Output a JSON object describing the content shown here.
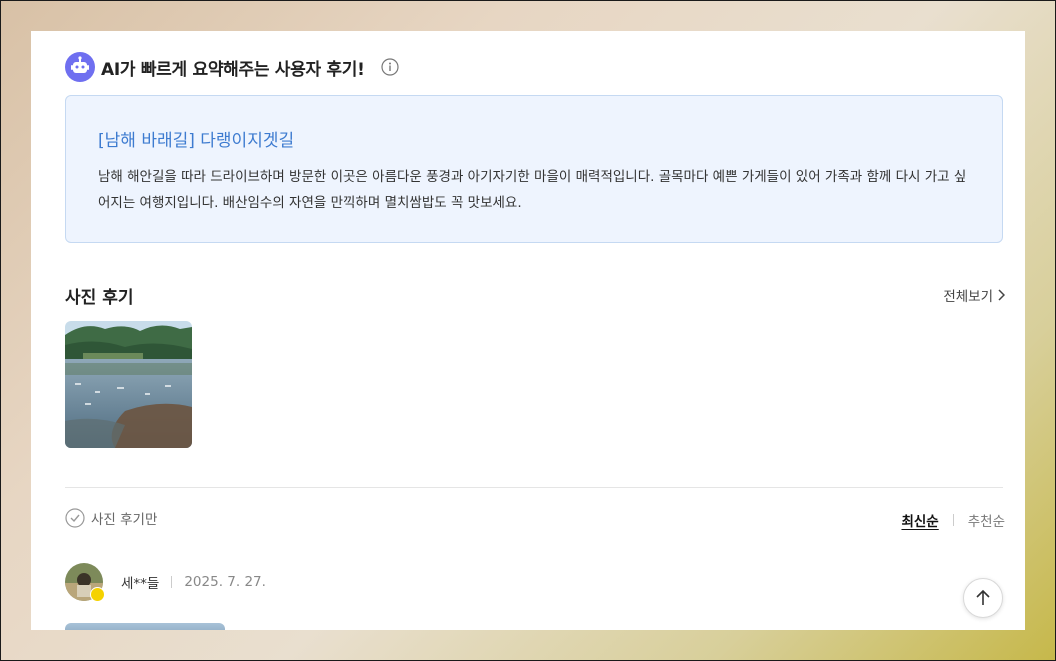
{
  "ai_summary": {
    "header_title": "AI가 빠르게 요약해주는 사용자 후기!",
    "place_title": "[남해 바래길] 다랭이지겟길",
    "text": "남해 해안길을 따라 드라이브하며 방문한 이곳은 아름다운 풍경과 아기자기한 마을이 매력적입니다. 골목마다 예쁜 가게들이 있어 가족과 함께 다시 가고 싶어지는 여행지입니다. 배산임수의 자연을 만끽하며 멸치쌈밥도 꼭 맛보세요."
  },
  "photo_reviews": {
    "title": "사진 후기",
    "view_all_label": "전체보기"
  },
  "filters": {
    "photo_only_label": "사진 후기만",
    "sort_latest": "최신순",
    "sort_recommended": "추천순"
  },
  "review": {
    "author": "세**들",
    "date": "2025. 7. 27."
  },
  "colors": {
    "accent_blue": "#3d7bd0",
    "summary_bg": "#eef4fe",
    "bot_icon": "#6f6ff0"
  },
  "icons": [
    "robot-icon",
    "info-icon",
    "chevron-right-icon",
    "check-circle-icon",
    "kakao-badge-icon",
    "arrow-up-icon"
  ]
}
